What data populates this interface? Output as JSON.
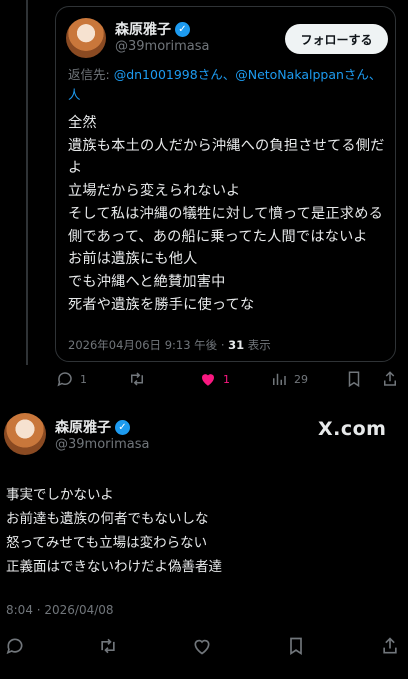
{
  "quoted_tweet": {
    "author_name": "森原雅子",
    "author_handle": "@39morimasa",
    "follow_label": "フォローする",
    "reply_prefix": "返信先: ",
    "reply_mentions": "@dn1001998さん、@NetoNakalppanさん、",
    "reply_mentions_line2": "人",
    "body": "全然\n遺族も本土の人だから沖縄への負担させてる側だよ\n立場だから変えられないよ\nそして私は沖縄の犠牲に対して憤って是正求める側であって、あの船に乗ってた人間ではないよ\nお前は遺族にも他人\nでも沖縄へと絶賛加害中\n死者や遺族を勝手に使ってな",
    "timestamp": "2026年04月06日 9:13 午後 · ",
    "views_count": "31",
    "views_label": " 表示",
    "actions": {
      "replies": "1",
      "reposts": "",
      "likes": "1",
      "views": "29"
    },
    "colors": {
      "like": "#f91880",
      "link": "#1d9bf0"
    }
  },
  "main_tweet": {
    "author_name": "森原雅子",
    "author_handle": "@39morimasa",
    "platform_label": "X.com",
    "body": "事実でしかないよ\nお前達も遺族の何者でもないしな\n怒ってみせても立場は変わらない\n正義面はできないわけだよ偽善者達",
    "timestamp": "8:04 · 2026/04/08"
  }
}
